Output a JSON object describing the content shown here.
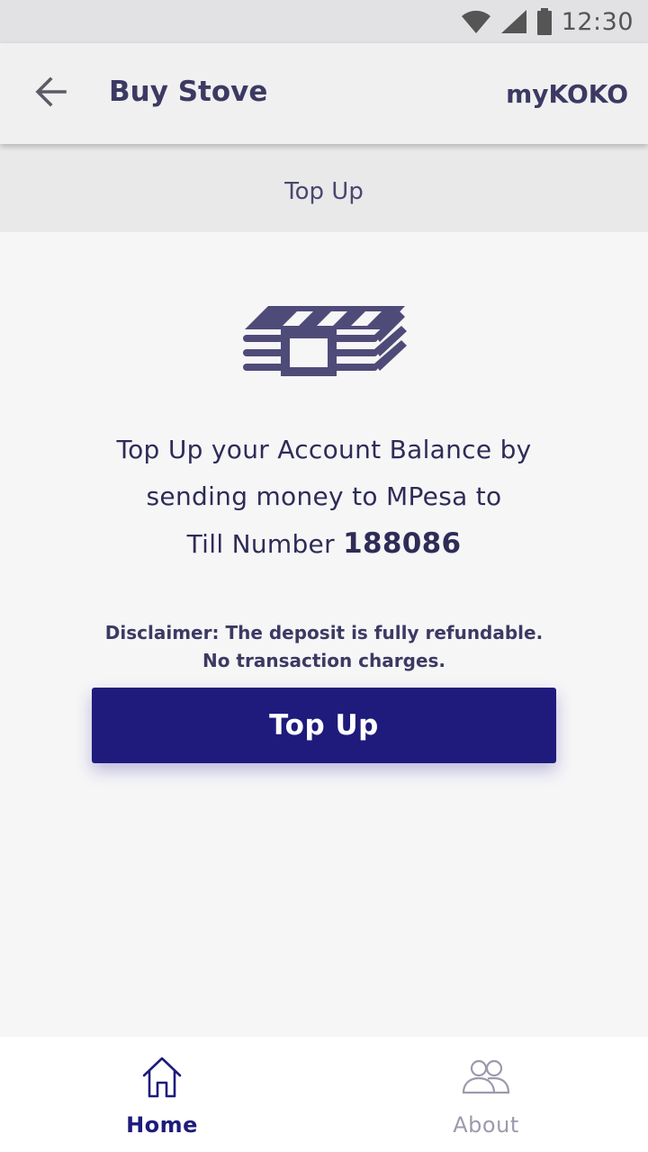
{
  "status_bar": {
    "time": "12:30",
    "icons": [
      "wifi-icon",
      "signal-icon",
      "battery-icon"
    ]
  },
  "app_bar": {
    "back_icon": "arrow-left-icon",
    "title": "Buy Stove",
    "brand": "myKOKO"
  },
  "section_header": {
    "title": "Top Up"
  },
  "content": {
    "icon": "money-stack-icon",
    "instruction_line1": "Top Up your Account Balance by",
    "instruction_line2": "sending money to MPesa to",
    "till_label": "Till Number",
    "till_number": "188086",
    "disclaimer_line1": "Disclaimer: The deposit is fully refundable.",
    "disclaimer_line2": "No transaction charges.",
    "button_label": "Top Up"
  },
  "bottom_nav": {
    "items": [
      {
        "label": "Home",
        "icon": "home-icon",
        "active": true
      },
      {
        "label": "About",
        "icon": "people-icon",
        "active": false
      }
    ]
  },
  "colors": {
    "primary": "#1e1b7c",
    "text": "#3c3a63",
    "icon": "#4f4b78",
    "inactive": "#9b9aae",
    "background": "#f6f6f7"
  }
}
